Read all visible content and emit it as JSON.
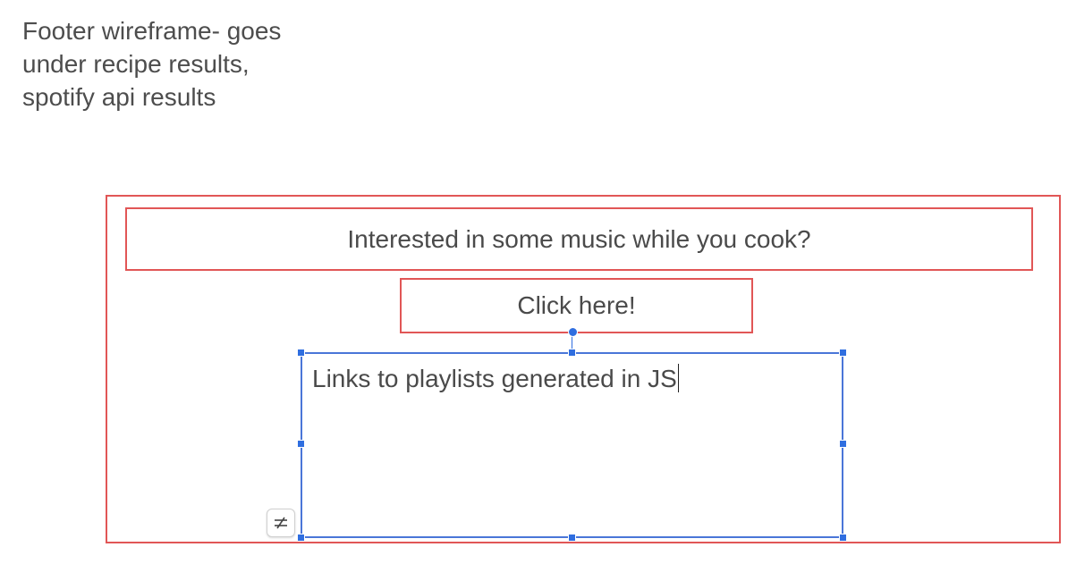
{
  "note": {
    "lines": [
      "Footer wireframe- goes",
      "under recipe results,",
      "spotify api results"
    ]
  },
  "footer": {
    "headline": "Interested in some music while you cook?",
    "cta_label": "Click here!",
    "playlist_text": "Links to playlists generated in JS"
  },
  "colors": {
    "wireframe_border": "#e15656",
    "selection": "#2f6ee0",
    "text": "#4a4a4a"
  },
  "icons": {
    "wrap_toggle": "strikethrough-wrap-icon"
  }
}
